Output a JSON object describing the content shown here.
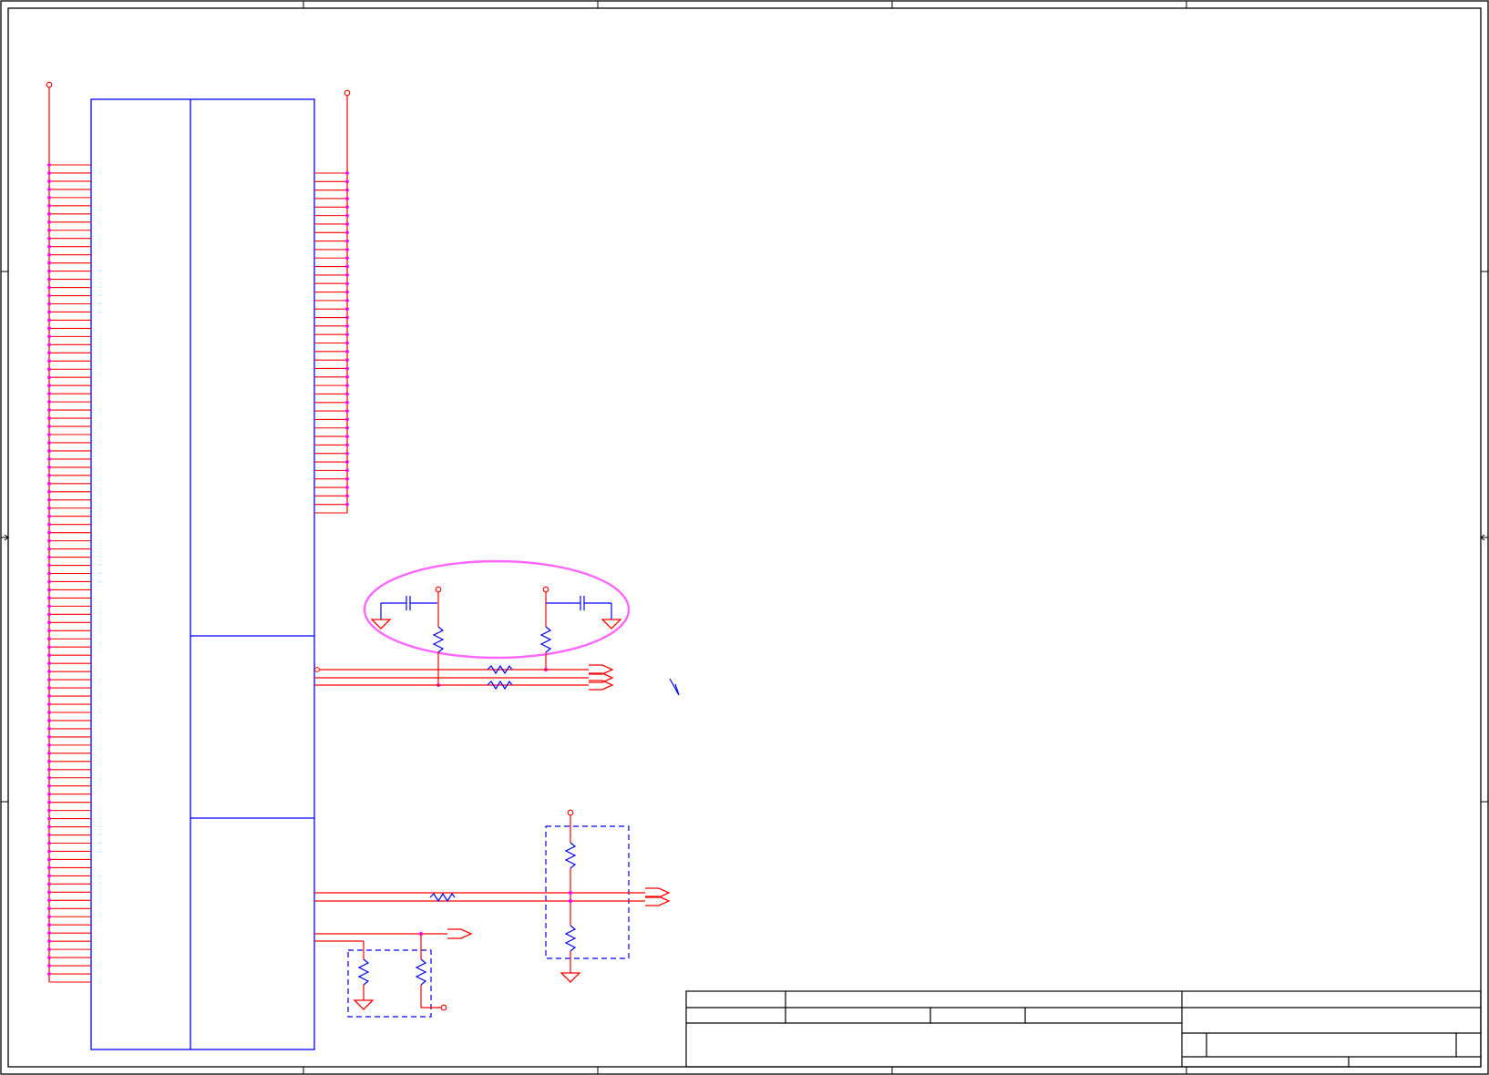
{
  "sheet": {
    "colors": {
      "wire": "#ff0000",
      "pin_dot": "#ff00ff",
      "component": "#0000ff",
      "highlight": "#ff66ff",
      "frame": "#000000"
    }
  },
  "connector": {
    "left_pin_rows": 101,
    "right_pin_rows": 41
  },
  "title_block": {
    "fields": []
  }
}
